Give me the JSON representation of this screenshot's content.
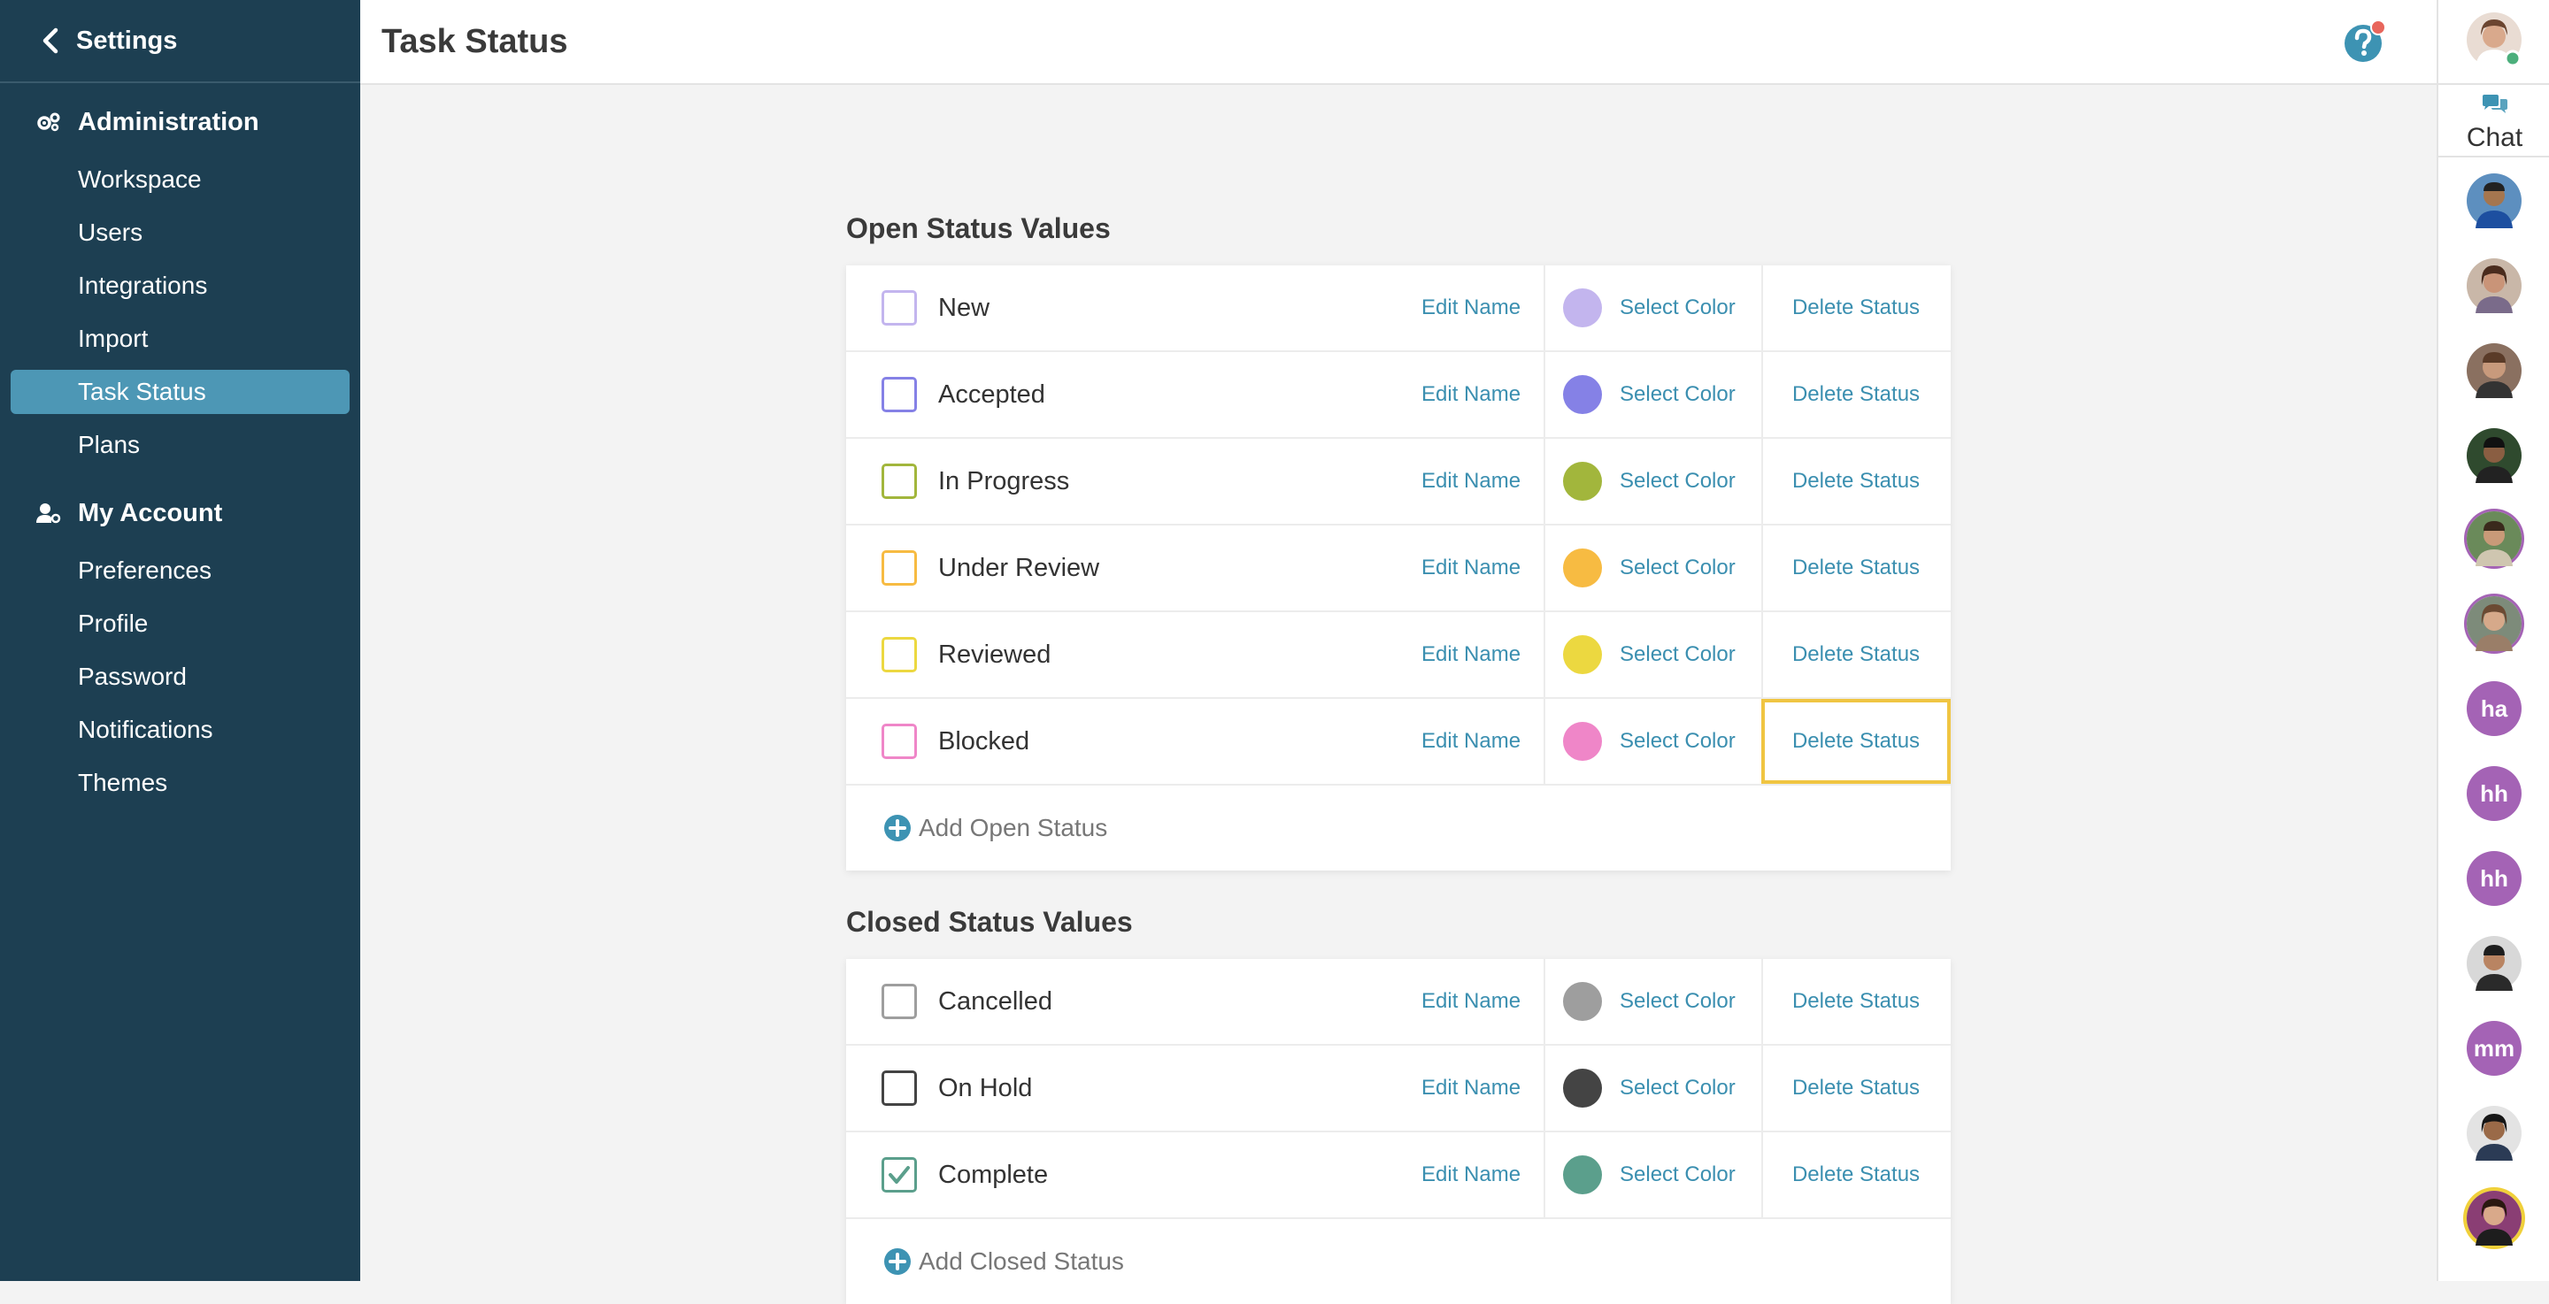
{
  "sidebar": {
    "title": "Settings",
    "administration": {
      "label": "Administration",
      "items": [
        "Workspace",
        "Users",
        "Integrations",
        "Import",
        "Task Status",
        "Plans"
      ]
    },
    "my_account": {
      "label": "My Account",
      "items": [
        "Preferences",
        "Profile",
        "Password",
        "Notifications",
        "Themes"
      ]
    },
    "active_item": "Task Status"
  },
  "header": {
    "title": "Task Status"
  },
  "chat": {
    "label": "Chat",
    "initials": [
      "ha",
      "hh",
      "hh",
      "mm"
    ]
  },
  "open_status": {
    "title": "Open Status Values",
    "add_label": "Add Open Status",
    "rows": [
      {
        "name": "New",
        "color": "#c3b5ee"
      },
      {
        "name": "Accepted",
        "color": "#8581e6"
      },
      {
        "name": "In Progress",
        "color": "#a2b63c"
      },
      {
        "name": "Under Review",
        "color": "#f7bb42"
      },
      {
        "name": "Reviewed",
        "color": "#ecd840"
      },
      {
        "name": "Blocked",
        "color": "#ef86c8"
      }
    ]
  },
  "closed_status": {
    "title": "Closed Status Values",
    "add_label": "Add Closed Status",
    "rows": [
      {
        "name": "Cancelled",
        "color": "#9e9e9e"
      },
      {
        "name": "On Hold",
        "color": "#444444"
      },
      {
        "name": "Complete",
        "color": "#5b9f8c"
      }
    ]
  },
  "actions": {
    "edit_name": "Edit Name",
    "select_color": "Select Color",
    "delete_status": "Delete Status"
  },
  "colors": {
    "sidebar_bg": "#1d3f52",
    "active_item": "#4d97b5",
    "link": "#3b8fb0",
    "focus_outline": "#f0c542",
    "avatar_purple": "#a463b5"
  }
}
